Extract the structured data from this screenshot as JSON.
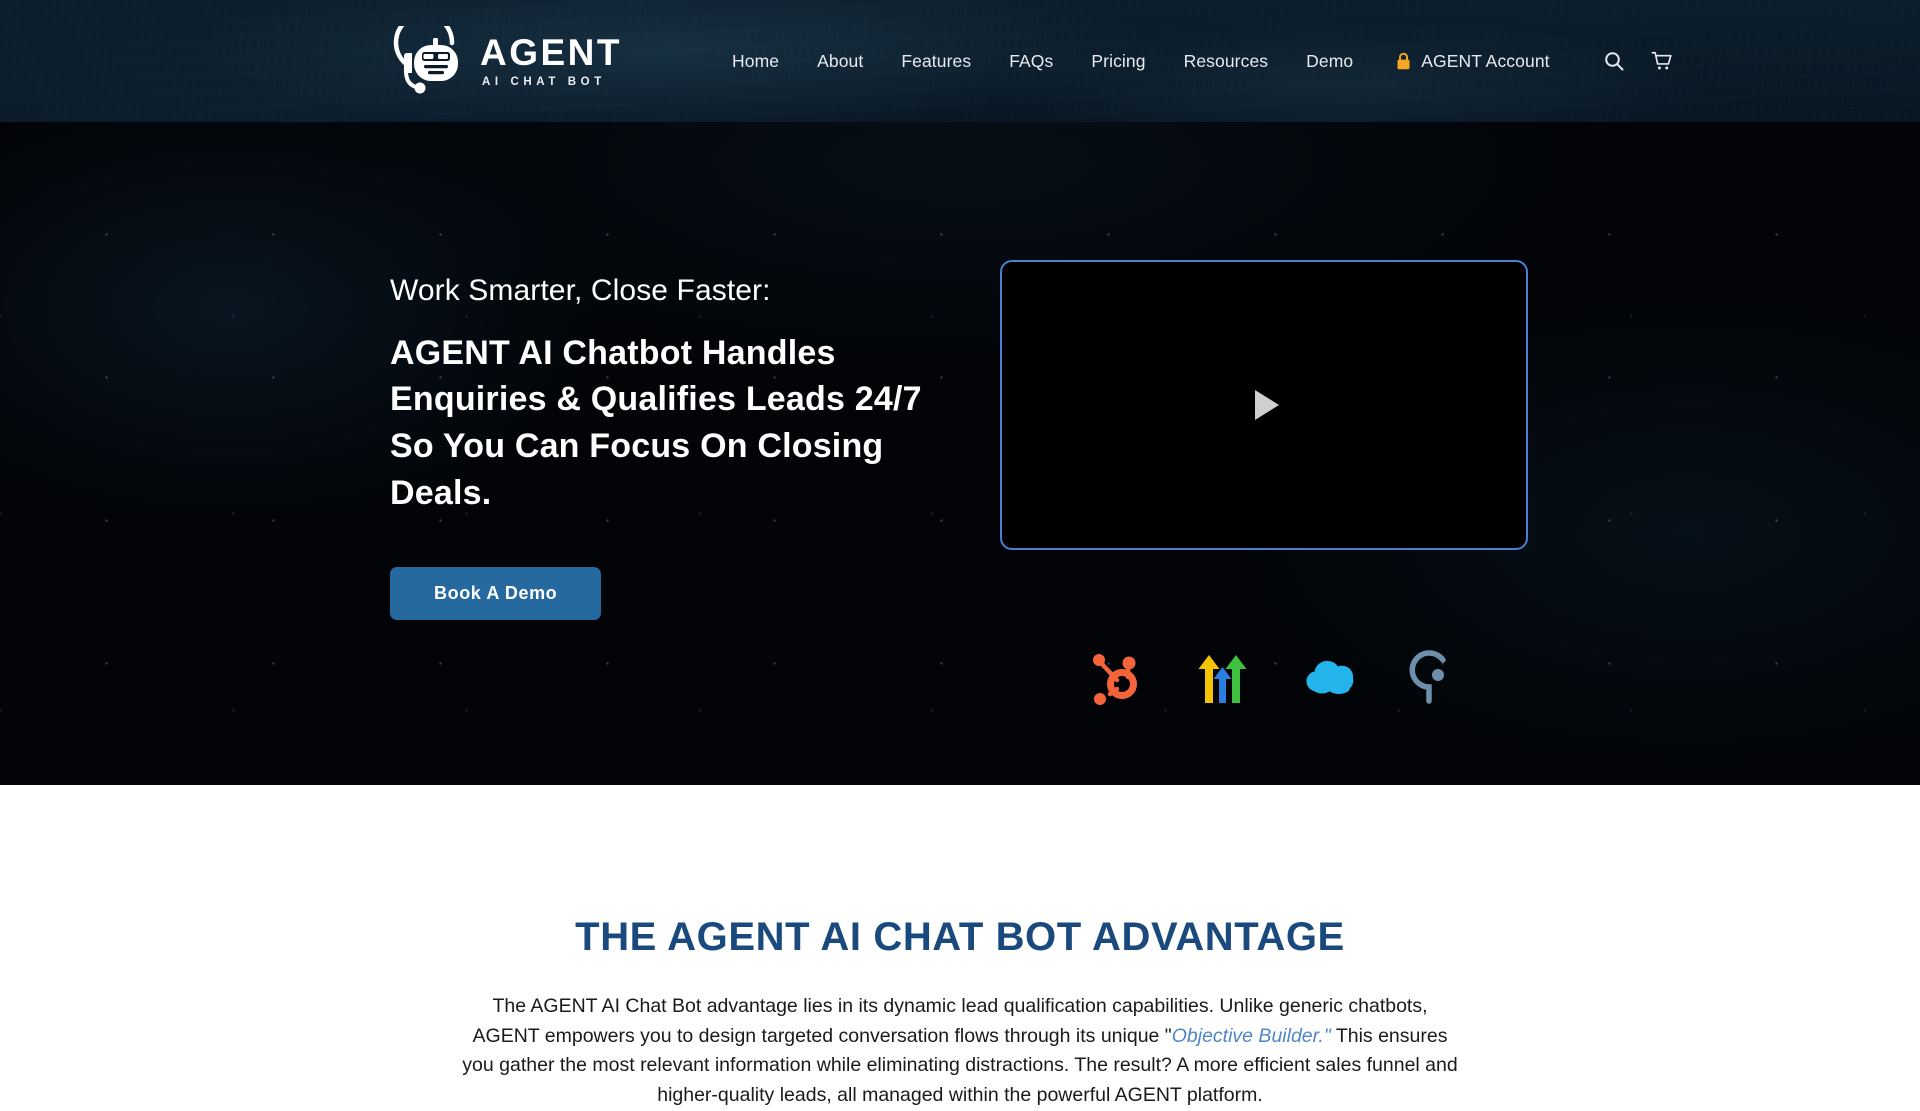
{
  "header": {
    "logo": {
      "icon": "agent-robot-headset-icon",
      "word": "AGENT",
      "sub": "AI CHAT BOT"
    },
    "nav_items": [
      {
        "label": "Home"
      },
      {
        "label": "About"
      },
      {
        "label": "Features"
      },
      {
        "label": "FAQs"
      },
      {
        "label": "Pricing"
      },
      {
        "label": "Resources"
      },
      {
        "label": "Demo"
      }
    ],
    "account": {
      "label": "AGENT Account",
      "icon": "lock-icon",
      "lock_color": "#f5a623"
    },
    "icons": [
      {
        "name": "search-icon"
      },
      {
        "name": "cart-icon"
      }
    ],
    "background_color": "#0a1a27"
  },
  "hero": {
    "eyebrow": "Work Smarter, Close Faster:",
    "title": "AGENT AI Chatbot Handles Enquiries & Qualifies Leads 24/7 So You Can Focus On Closing Deals.",
    "cta_label": "Book A Demo",
    "cta_color": "#26699f",
    "video": {
      "state": "paused",
      "play_icon": "play-triangle-icon",
      "border_color": "#4a7fd4",
      "screen_color": "#000000"
    },
    "integrations": [
      {
        "name": "hubspot-logo",
        "color": "#f5633a"
      },
      {
        "name": "zoho-arrows-logo",
        "colors": [
          "#f5c400",
          "#2a7de1",
          "#3ec13e"
        ]
      },
      {
        "name": "salesforce-cloud-logo",
        "color": "#22b4ea"
      },
      {
        "name": "pipedrive-logo",
        "color": "#6e8faa"
      }
    ],
    "background_color": "#020407"
  },
  "advantage": {
    "title": "THE AGENT AI CHAT BOT ADVANTAGE",
    "title_color": "#1a4a7d",
    "body_part1": "The AGENT AI Chat Bot advantage lies in its dynamic lead qualification capabilities. Unlike generic chatbots, AGENT empowers you to design targeted conversation flows through its unique \"",
    "body_link": "Objective Builder.\"",
    "body_part2": " This ensures you gather the most relevant information while eliminating distractions. The result? A more efficient sales funnel and higher-quality leads, all managed within the powerful AGENT platform.",
    "link_color": "#4f86c6"
  }
}
